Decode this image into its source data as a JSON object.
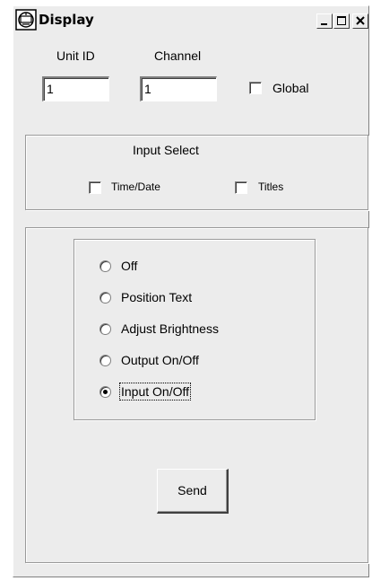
{
  "window": {
    "title": "Display",
    "icon": "display-app-icon",
    "controls": {
      "minimize_icon": "minimize-icon",
      "maximize_icon": "maximize-icon",
      "close_icon": "close-icon"
    }
  },
  "unit_id": {
    "label": "Unit ID",
    "value": "1"
  },
  "channel": {
    "label": "Channel",
    "value": "1"
  },
  "global": {
    "label": "Global",
    "checked": false
  },
  "input_select": {
    "title": "Input Select",
    "options": [
      {
        "label": "Time/Date",
        "checked": false
      },
      {
        "label": "Titles",
        "checked": false
      }
    ]
  },
  "mode": {
    "options": [
      {
        "label": "Off",
        "selected": false
      },
      {
        "label": "Position Text",
        "selected": false
      },
      {
        "label": "Adjust Brightness",
        "selected": false
      },
      {
        "label": "Output On/Off",
        "selected": false
      },
      {
        "label": "Input On/Off",
        "selected": true
      }
    ]
  },
  "send_button": {
    "label": "Send"
  },
  "colors": {
    "window_bg": "#ececec",
    "field_bg": "#ffffff",
    "shadow": "#808080"
  }
}
